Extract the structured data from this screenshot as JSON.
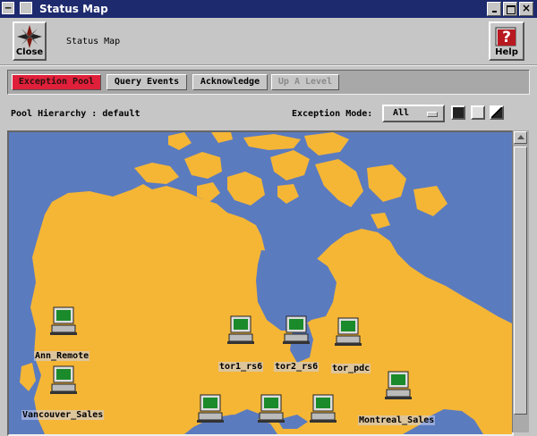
{
  "window": {
    "title": "Status Map"
  },
  "toolbar": {
    "close_label": "Close",
    "help_label": "Help",
    "status_label": "Status Map"
  },
  "tabs": [
    {
      "label": "Exception Pool",
      "state": "active"
    },
    {
      "label": "Query Events",
      "state": "normal"
    },
    {
      "label": "Acknowledge",
      "state": "normal"
    },
    {
      "label": "Up A Level",
      "state": "disabled"
    }
  ],
  "pool": {
    "label": "Pool Hierarchy : default"
  },
  "exception_mode": {
    "label": "Exception Mode:",
    "value": "All"
  },
  "map": {
    "ocean_color": "#5b7bbf",
    "land_color": "#f5b636",
    "nodes": [
      {
        "name": "Ann_Remote"
      },
      {
        "name": "Vancouver_Sales"
      },
      {
        "name": "tor1_rs6"
      },
      {
        "name": "tor2_rs6"
      },
      {
        "name": "tor_pdc"
      },
      {
        "name": "Montreal_Sales"
      },
      {
        "name": ""
      },
      {
        "name": ""
      },
      {
        "name": ""
      }
    ]
  },
  "icons": [
    "compass-icon",
    "help-book-icon",
    "computer-icon"
  ]
}
